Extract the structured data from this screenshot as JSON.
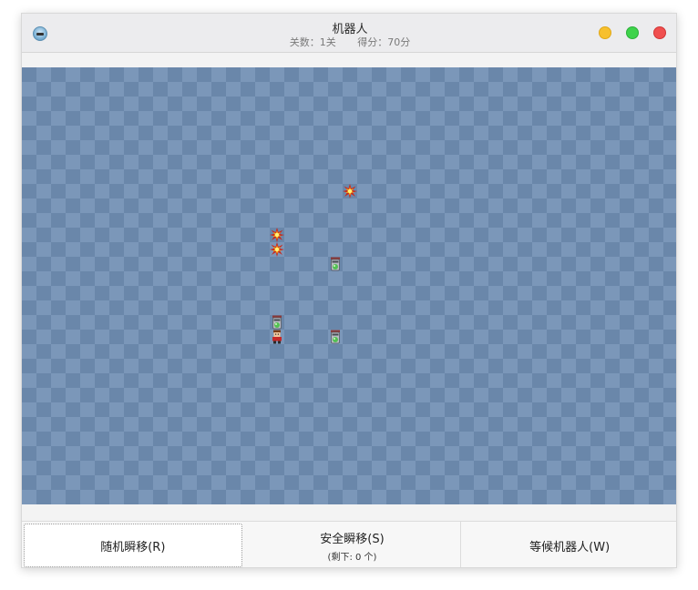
{
  "window": {
    "title": "机器人",
    "level": "关数：1关",
    "score": "得分：70分"
  },
  "board": {
    "cols": 45,
    "rows": 30,
    "colors": {
      "dark": "#6a87aa",
      "light": "#7b97b9"
    },
    "explosions": [
      {
        "col": 22,
        "row": 8
      },
      {
        "col": 17,
        "row": 11
      },
      {
        "col": 17,
        "row": 12
      }
    ],
    "robots": [
      {
        "col": 21,
        "row": 13
      },
      {
        "col": 17,
        "row": 17
      },
      {
        "col": 21,
        "row": 18
      }
    ],
    "player": {
      "col": 17,
      "row": 18
    }
  },
  "buttons": {
    "random_teleport": "随机瞬移(R)",
    "safe_teleport": "安全瞬移(S)",
    "safe_teleport_remaining": "(剩下: 0 个)",
    "wait_for_robots": "等候机器人(W)"
  }
}
